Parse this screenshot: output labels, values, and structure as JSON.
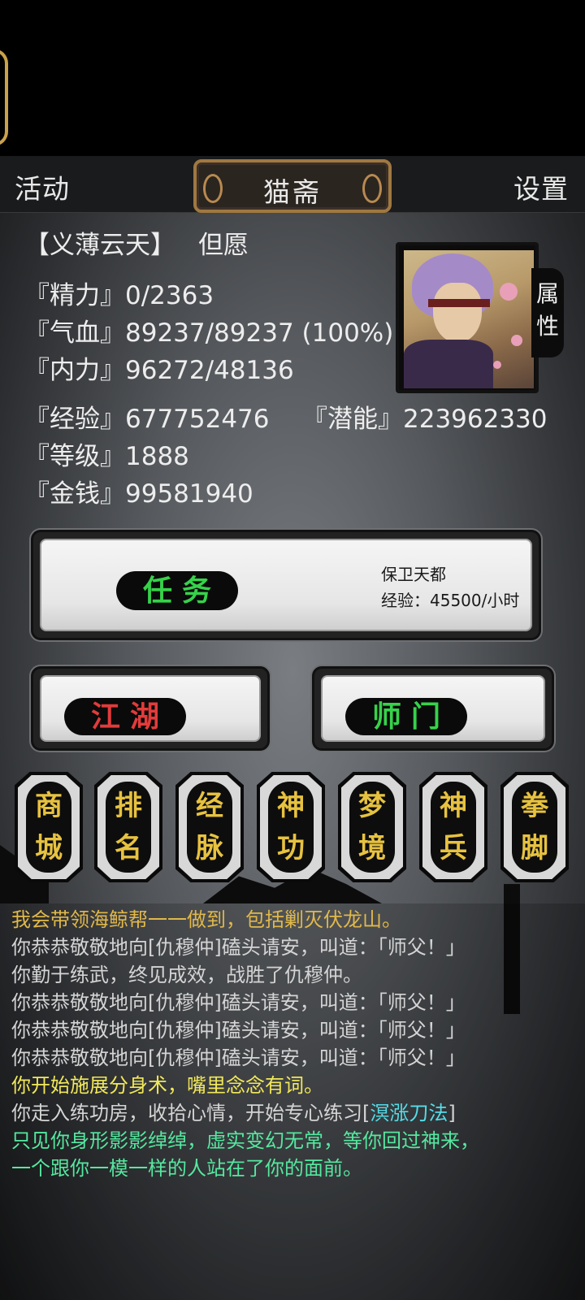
{
  "menu": {
    "left_label": "活动",
    "title": "猫斋",
    "right_label": "设置"
  },
  "character": {
    "title": "【义薄云天】",
    "name": "但愿",
    "energy_label": "『精力』",
    "energy_value": "0/2363",
    "hp_label": "『气血』",
    "hp_value": "89237/89237 (100%)",
    "mp_label": "『内力』",
    "mp_value": "96272/48136",
    "exp_label": "『经验』",
    "exp_value": "677752476",
    "potential_label": "『潜能』",
    "potential_value": "223962330",
    "level_label": "『等级』",
    "level_value": "1888",
    "gold_label": "『金钱』",
    "gold_value": "99581940",
    "attributes_tab": "属性"
  },
  "actions": {
    "task": {
      "label": "任务",
      "info_line1": "保卫天都",
      "info_line2": "经验：45500/小时"
    },
    "jianghu": {
      "label": "江湖"
    },
    "shimen": {
      "label": "师门"
    }
  },
  "hex_buttons": [
    "商城",
    "排名",
    "经脉",
    "神功",
    "梦境",
    "神兵",
    "拳脚"
  ],
  "log": [
    {
      "text": "我会带领海鲸帮一一做到，包括剿灭伏龙山。",
      "color": "gold"
    },
    {
      "text": "你恭恭敬敬地向[仇穆仲]磕头请安，叫道：「师父！」",
      "color": "gray"
    },
    {
      "text": "你勤于练武，终见成效，战胜了仇穆仲。",
      "color": "gray"
    },
    {
      "text": "你恭恭敬敬地向[仇穆仲]磕头请安，叫道：「师父！」",
      "color": "gray"
    },
    {
      "text": "你恭恭敬敬地向[仇穆仲]磕头请安，叫道：「师父！」",
      "color": "gray"
    },
    {
      "text": "你恭恭敬敬地向[仇穆仲]磕头请安，叫道：「师父！」",
      "color": "gray"
    },
    {
      "text": "你开始施展分身术，嘴里念念有词。",
      "color": "yellow"
    },
    {
      "text_a": "你走入练功房，收拾心情，开始专心练习[",
      "skill": "溟涨刀法",
      "text_b": "]",
      "color": "gray"
    },
    {
      "text": "只见你身形影影绰绰，虚实变幻无常，等你回过神来，",
      "color": "green"
    },
    {
      "text": "一个跟你一模一样的人站在了你的面前。",
      "color": "green"
    }
  ],
  "colors": {
    "task_green": "#36d24a",
    "jianghu_red": "#e23b3b",
    "button_gold": "#e7c240",
    "log_gold": "#e0b84a",
    "log_green": "#55e8a0",
    "log_cyan": "#54dce8",
    "log_yellow": "#f1e85a"
  }
}
